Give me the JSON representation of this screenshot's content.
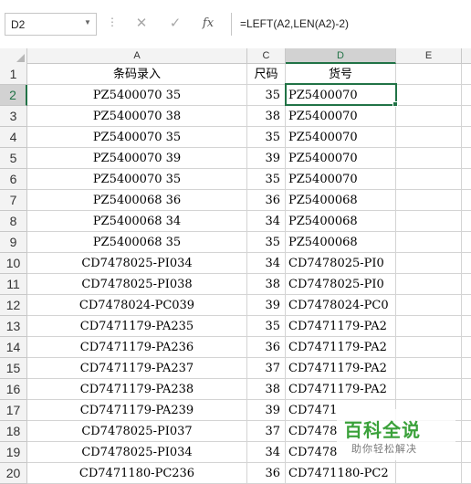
{
  "formula_bar": {
    "name_box": "D2",
    "more": "⋮",
    "cancel_glyph": "✕",
    "enter_glyph": "✓",
    "fx_label": "fx",
    "formula": "=LEFT(A2,LEN(A2)-2)"
  },
  "columns": [
    "A",
    "C",
    "D",
    "E"
  ],
  "rows": [
    {
      "num": "1",
      "a": "条码录入",
      "c": "尺码",
      "d": "货号"
    },
    {
      "num": "2",
      "a": "PZ5400070 35",
      "c": "35",
      "d": "PZ5400070"
    },
    {
      "num": "3",
      "a": "PZ5400070 38",
      "c": "38",
      "d": "PZ5400070"
    },
    {
      "num": "4",
      "a": "PZ5400070 35",
      "c": "35",
      "d": "PZ5400070"
    },
    {
      "num": "5",
      "a": "PZ5400070 39",
      "c": "39",
      "d": "PZ5400070"
    },
    {
      "num": "6",
      "a": "PZ5400070 35",
      "c": "35",
      "d": "PZ5400070"
    },
    {
      "num": "7",
      "a": "PZ5400068 36",
      "c": "36",
      "d": "PZ5400068"
    },
    {
      "num": "8",
      "a": "PZ5400068 34",
      "c": "34",
      "d": "PZ5400068"
    },
    {
      "num": "9",
      "a": "PZ5400068 35",
      "c": "35",
      "d": "PZ5400068"
    },
    {
      "num": "10",
      "a": "CD7478025-PI034",
      "c": "34",
      "d": "CD7478025-PI0"
    },
    {
      "num": "11",
      "a": "CD7478025-PI038",
      "c": "38",
      "d": "CD7478025-PI0"
    },
    {
      "num": "12",
      "a": "CD7478024-PC039",
      "c": "39",
      "d": "CD7478024-PC0"
    },
    {
      "num": "13",
      "a": "CD7471179-PA235",
      "c": "35",
      "d": "CD7471179-PA2"
    },
    {
      "num": "14",
      "a": "CD7471179-PA236",
      "c": "36",
      "d": "CD7471179-PA2"
    },
    {
      "num": "15",
      "a": "CD7471179-PA237",
      "c": "37",
      "d": "CD7471179-PA2"
    },
    {
      "num": "16",
      "a": "CD7471179-PA238",
      "c": "38",
      "d": "CD7471179-PA2"
    },
    {
      "num": "17",
      "a": "CD7471179-PA239",
      "c": "39",
      "d": "CD7471"
    },
    {
      "num": "18",
      "a": "CD7478025-PI037",
      "c": "37",
      "d": "CD7478"
    },
    {
      "num": "19",
      "a": "CD7478025-PI034",
      "c": "34",
      "d": "CD7478"
    },
    {
      "num": "20",
      "a": "CD7471180-PC236",
      "c": "36",
      "d": "CD7471180-PC2"
    }
  ],
  "watermark": {
    "title": "百科全说",
    "subtitle": "助你轻松解决"
  },
  "colors": {
    "accent": "#217346",
    "watermark_green": "#3aa13a"
  }
}
